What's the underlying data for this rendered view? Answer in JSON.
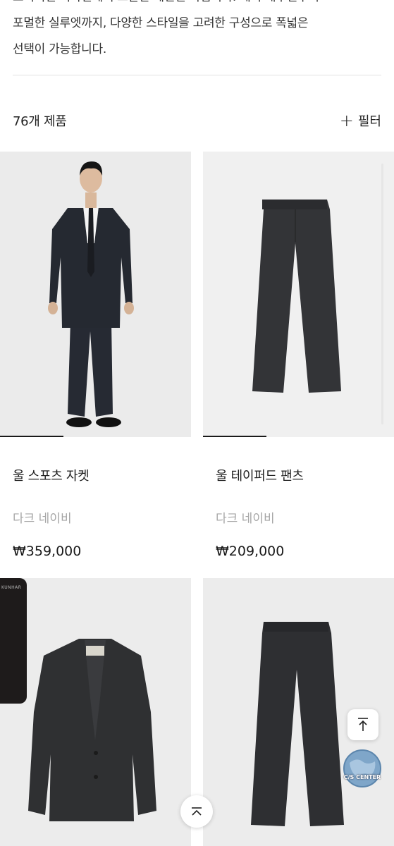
{
  "intro": {
    "line1": "오리지널 디자인에서 고찰한 세련된 룩입니다. 세미 캐주얼부터",
    "line2": "포멀한 실루엣까지, 다양한 스타일을 고려한 구성으로 폭넓은",
    "line3": "선택이 가능합니다."
  },
  "list_header": {
    "count": "76개 제품",
    "filter_label": "필터"
  },
  "products": [
    {
      "name": "울 스포츠 자켓",
      "color": "다크 네이비",
      "price": "₩359,000",
      "image": "model-wearing-suit",
      "slide_progress": 0.33
    },
    {
      "name": "울 테이퍼드 팬츠",
      "color": "다크 네이비",
      "price": "₩209,000",
      "image": "dark-trousers",
      "slide_progress": 0.33
    },
    {
      "image": "dark-blazer"
    },
    {
      "image": "dark-trousers"
    }
  ],
  "badge": {
    "text": "KUNHAR"
  },
  "floating": {
    "top_icon": "arrow-up-to-line-icon",
    "cs_label": "C/S CENTER",
    "scroll_up_icon": "chevron-up-icon"
  }
}
